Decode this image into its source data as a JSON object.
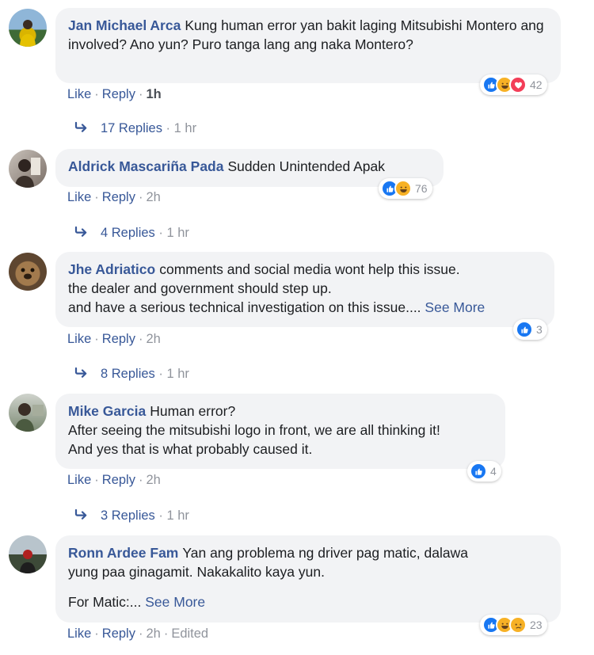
{
  "comments": [
    {
      "author": "Jan Michael Arca",
      "text": "Kung human error yan bakit laging Mitsubishi Montero ang involved? Ano yun? Puro tanga lang ang naka Montero?",
      "like": "Like",
      "reply": "Reply",
      "time": "1h",
      "reaction_count": "42",
      "reactions": [
        "like",
        "haha",
        "love"
      ],
      "replies": "17 Replies",
      "replies_time": "1 hr"
    },
    {
      "author": "Aldrick Mascariña Pada",
      "text": "Sudden Unintended Apak",
      "like": "Like",
      "reply": "Reply",
      "time": "2h",
      "reaction_count": "76",
      "reactions": [
        "like",
        "haha"
      ],
      "replies": "4 Replies",
      "replies_time": "1 hr"
    },
    {
      "author": "Jhe Adriatico",
      "text_lines": [
        "comments and social media wont help this issue.",
        "the dealer and government should step up.",
        "and have a serious technical investigation on this issue...."
      ],
      "see_more": "See More",
      "like": "Like",
      "reply": "Reply",
      "time": "2h",
      "reaction_count": "3",
      "reactions": [
        "like"
      ],
      "replies": "8 Replies",
      "replies_time": "1 hr"
    },
    {
      "author": "Mike Garcia",
      "text_lines": [
        "Human error?",
        "After seeing the mitsubishi logo in front, we are all thinking it!",
        "And yes that is what probably caused it."
      ],
      "like": "Like",
      "reply": "Reply",
      "time": "2h",
      "reaction_count": "4",
      "reactions": [
        "like"
      ],
      "replies": "3 Replies",
      "replies_time": "1 hr"
    },
    {
      "author": "Ronn Ardee Fam",
      "text_lines": [
        "Yan ang problema ng driver pag matic, dalawa",
        "yung paa ginagamit. Nakakalito kaya yun."
      ],
      "text_extra": "For Matic:...",
      "see_more": "See More",
      "like": "Like",
      "reply": "Reply",
      "time": "2h",
      "edited": "Edited",
      "reaction_count": "23",
      "reactions": [
        "like",
        "haha",
        "sad"
      ]
    }
  ],
  "colors": {
    "link": "#385898",
    "bubble": "#f2f3f5",
    "like": "#1877f2",
    "haha": "#f7b125",
    "love": "#f33e58"
  },
  "icons": {
    "reply_arrow": "reply-arrow-icon",
    "like": "like-reaction-icon",
    "haha": "haha-reaction-icon",
    "love": "love-reaction-icon",
    "sad": "sad-reaction-icon"
  }
}
